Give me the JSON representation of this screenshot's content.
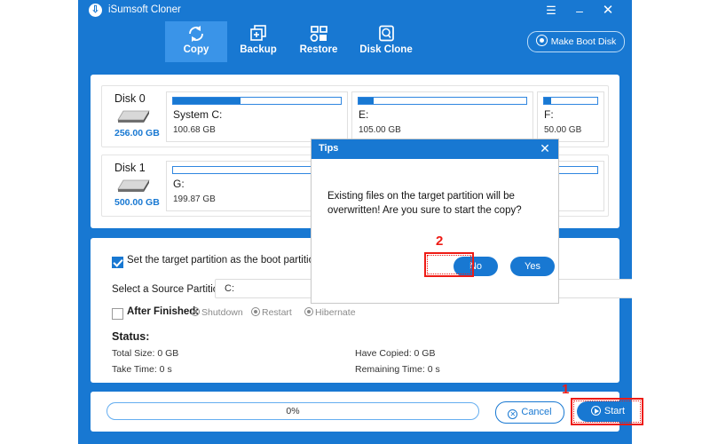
{
  "window": {
    "title": "iSumsoft Cloner",
    "logo_icon": "download-circle-icon",
    "menu_icon": "hamburger-menu-icon",
    "minimize_icon": "minimize-icon",
    "close_icon": "close-icon"
  },
  "toolbar": {
    "tabs": [
      {
        "label": "Copy",
        "icon": "copy-refresh-icon",
        "active": true
      },
      {
        "label": "Backup",
        "icon": "backup-plus-icon",
        "active": false
      },
      {
        "label": "Restore",
        "icon": "restore-grid-icon",
        "active": false
      },
      {
        "label": "Disk Clone",
        "icon": "disk-clone-icon",
        "active": false
      }
    ],
    "make_boot_disk_label": "Make Boot Disk",
    "make_boot_disk_icon": "disc-icon"
  },
  "disks": [
    {
      "name": "Disk 0",
      "size": "256.00 GB",
      "icon": "hard-drive-icon",
      "partitions": [
        {
          "name": "System C:",
          "size": "100.68 GB",
          "fill_percent": 40
        },
        {
          "name": "E:",
          "size": "105.00 GB",
          "fill_percent": 9
        },
        {
          "name": "F:",
          "size": "50.00 GB",
          "fill_percent": 7
        }
      ]
    },
    {
      "name": "Disk 1",
      "size": "500.00 GB",
      "icon": "hard-drive-icon",
      "partitions": [
        {
          "name": "G:",
          "size": "199.87 GB",
          "fill_percent": 0
        }
      ]
    }
  ],
  "settings": {
    "target_checkbox_label": "Set the target partition as the boot partition",
    "target_checkbox_checked": true,
    "source_partition_label": "Select a Source Partition:",
    "source_partition_value": "C:",
    "source_partition_chevron": "chevron-down-icon",
    "after_finished_label": "After Finished:",
    "after_finished_checked": false,
    "after_finished_options": [
      "Shutdown",
      "Restart",
      "Hibernate"
    ]
  },
  "status": {
    "title": "Status:",
    "total_size": "Total Size: 0 GB",
    "take_time": "Take Time: 0 s",
    "have_copied": "Have Copied: 0 GB",
    "remaining_time": "Remaining Time: 0 s"
  },
  "bottom": {
    "progress_text": "0%",
    "progress_percent": 0,
    "cancel_label": "Cancel",
    "cancel_icon": "cancel-circle-icon",
    "start_label": "Start",
    "start_icon": "play-circle-icon"
  },
  "dialog": {
    "title": "Tips",
    "close_icon": "close-icon",
    "message": "Existing files on the target partition will be overwritten! Are you sure to start the copy?",
    "no_label": "No",
    "yes_label": "Yes"
  },
  "annotations": {
    "step_one": "1",
    "step_two": "2",
    "highlight_color": "#ee1b15"
  }
}
